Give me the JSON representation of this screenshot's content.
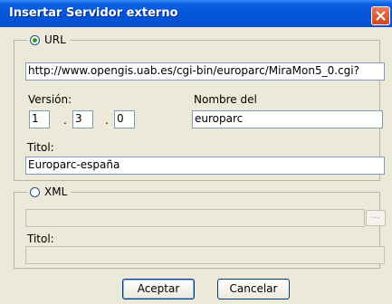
{
  "window": {
    "title": "Insertar Servidor externo"
  },
  "url_group": {
    "radio_label": "URL",
    "selected": true,
    "url_value": "http://www.opengis.uab.es/cgi-bin/europarc/MiraMon5_0.cgi?",
    "version_label": "Versión:",
    "version_major": "1",
    "version_minor": "3",
    "version_patch": "0",
    "separator": ".",
    "nombre_label": "Nombre del",
    "nombre_value": "europarc",
    "titol_label": "Titol:",
    "titol_value": "Europarc-españa"
  },
  "xml_group": {
    "radio_label": "XML",
    "selected": false,
    "xml_value": "",
    "browse_label": "...",
    "titol_label": "Titol:",
    "titol_value": ""
  },
  "buttons": {
    "accept": "Aceptar",
    "cancel": "Cancelar"
  }
}
